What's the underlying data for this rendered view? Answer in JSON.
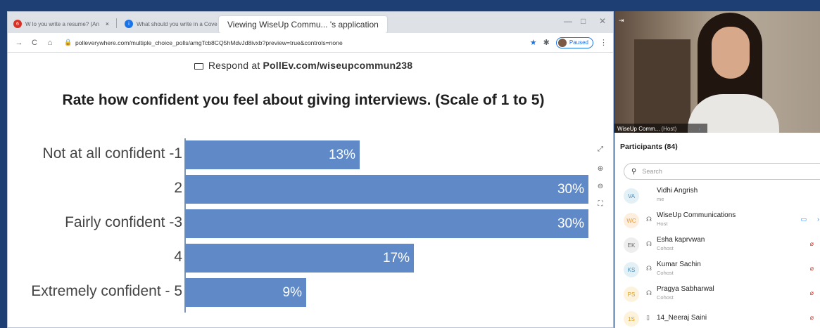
{
  "browser": {
    "tabs": [
      {
        "label": "W  lo you write a resume? (An",
        "favicon_color": "#d93025",
        "favicon": "6"
      },
      {
        "label": "What should you write in a Cove",
        "favicon_color": "#1a73e8",
        "favicon": "i"
      }
    ],
    "tab_close": "×",
    "sharing_banner": "Viewing WiseUp Commu...  's application",
    "window_controls": {
      "minimize": "—",
      "maximize": "□",
      "close": "✕"
    },
    "nav": {
      "back": "→",
      "reload": "C",
      "home": "⌂"
    },
    "url": "polleverywhere.com/multiple_choice_polls/amgTcb8CQ5hMdvJd8ivxb?preview=true&controls=none",
    "paused_label": "Paused"
  },
  "poll": {
    "respond_prefix": "Respond at",
    "respond_url": "PollEv.com/wiseupcommun238",
    "question": "Rate how confident you feel about giving interviews. (Scale of 1 to 5)"
  },
  "chart_data": {
    "type": "bar",
    "orientation": "horizontal",
    "categories": [
      "Not at all confident -1",
      "2",
      "Fairly confident -3",
      "4",
      "Extremely confident - 5"
    ],
    "values": [
      13,
      30,
      30,
      17,
      9
    ],
    "data_labels": [
      "13%",
      "30%",
      "30%",
      "17%",
      "9%"
    ],
    "xlim": [
      0,
      30
    ],
    "color": "#5f8ac7"
  },
  "video": {
    "name": "WiseUp Comm...",
    "role": "(Host)"
  },
  "participants": {
    "title": "Participants (84)",
    "search_placeholder": "Search",
    "list": [
      {
        "initials": "VA",
        "name": "Vidhi Angrish",
        "role": "me",
        "avatar_bg": "#e3f1f7",
        "avatar_fg": "#4a90b8",
        "headset": false,
        "status": "none"
      },
      {
        "initials": "WC",
        "name": "WiseUp Communications",
        "role": "Host",
        "avatar_bg": "#fdeede",
        "avatar_fg": "#e39b3a",
        "headset": true,
        "status": "video"
      },
      {
        "initials": "EK",
        "name": "Esha kaprvwan",
        "role": "Cohost",
        "avatar_bg": "#eeeeee",
        "avatar_fg": "#666666",
        "headset": true,
        "status": "muted"
      },
      {
        "initials": "KS",
        "name": "Kumar Sachin",
        "role": "Cohost",
        "avatar_bg": "#e3f1f7",
        "avatar_fg": "#4a90b8",
        "headset": true,
        "status": "muted"
      },
      {
        "initials": "PS",
        "name": "Pragya Sabharwal",
        "role": "Cohost",
        "avatar_bg": "#fdf3dc",
        "avatar_fg": "#d9a126",
        "headset": true,
        "status": "muted"
      },
      {
        "initials": "1S",
        "name": "14_Neeraj Saini",
        "role": "",
        "avatar_bg": "#fdf3dc",
        "avatar_fg": "#d9a126",
        "headset": false,
        "phone": true,
        "status": "muted"
      }
    ]
  }
}
